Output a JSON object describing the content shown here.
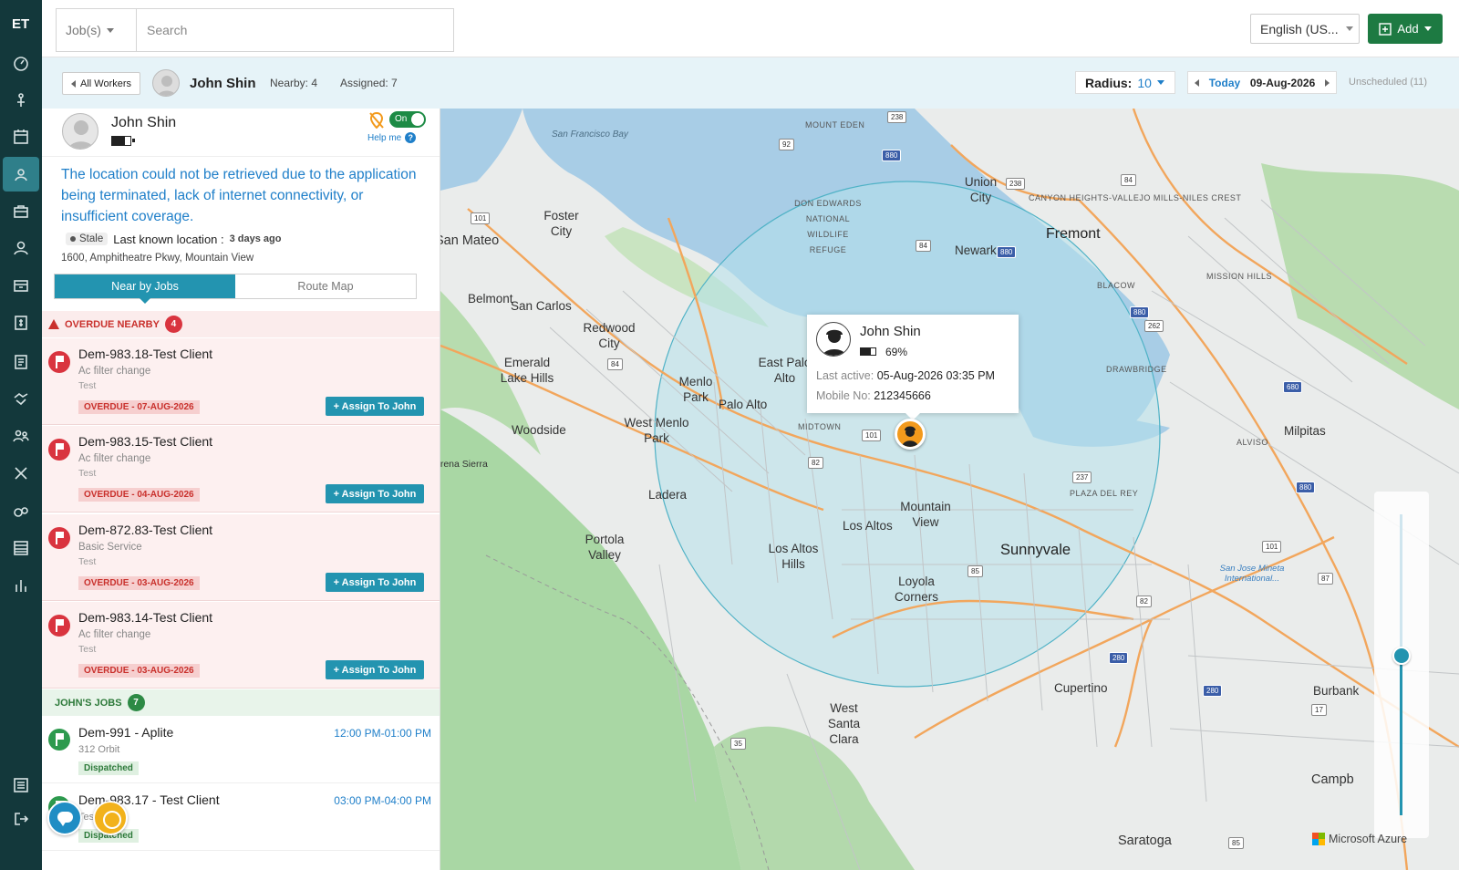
{
  "app": {
    "logo": "ET"
  },
  "rail": {
    "items": [
      "dashboard-icon",
      "route-icon",
      "calendar-icon",
      "location-user-icon",
      "briefcase-icon",
      "user-icon",
      "inventory-icon",
      "invoice-icon",
      "document-icon",
      "handshake-icon",
      "team-icon",
      "tools-icon",
      "rating-icon",
      "report-icon",
      "analytics-icon",
      "settings-icon",
      "logout-icon"
    ],
    "active_index": 3
  },
  "topbar": {
    "job_select": "Job(s)",
    "search_placeholder": "Search",
    "language": "English (US...",
    "add_label": "Add"
  },
  "subbar": {
    "all_workers": "All Workers",
    "worker_name": "John Shin",
    "nearby": "Nearby: 4",
    "assigned": "Assigned: 7",
    "radius_label": "Radius:",
    "radius_value": "10",
    "today": "Today",
    "date": "09-Aug-2026",
    "unscheduled": "Unscheduled (11)"
  },
  "panel": {
    "name": "John Shin",
    "toggle": "On",
    "help": "Help me",
    "message": "The location could not be retrieved due to the application being terminated, lack of internet connectivity, or insufficient coverage.",
    "stale": "Stale",
    "last_known": "Last known location :",
    "ago": "3 days ago",
    "address": "1600, Amphitheatre Pkwy, Mountain View",
    "tabs": [
      "Near by Jobs",
      "Route Map"
    ],
    "overdue_header": "OVERDUE NEARBY",
    "overdue_count": "4",
    "overdue_jobs": [
      {
        "title": "Dem-983.18-Test Client",
        "service": "Ac filter change",
        "note": "Test",
        "badge": "OVERDUE - 07-AUG-2026",
        "action": "+ Assign To John"
      },
      {
        "title": "Dem-983.15-Test Client",
        "service": "Ac filter change",
        "note": "Test",
        "badge": "OVERDUE - 04-AUG-2026",
        "action": "+ Assign To John"
      },
      {
        "title": "Dem-872.83-Test Client",
        "service": "Basic Service",
        "note": "Test",
        "badge": "OVERDUE - 03-AUG-2026",
        "action": "+ Assign To John"
      },
      {
        "title": "Dem-983.14-Test Client",
        "service": "Ac filter change",
        "note": "Test",
        "badge": "OVERDUE - 03-AUG-2026",
        "action": "+ Assign To John"
      }
    ],
    "my_jobs_header": "JOHN'S JOBS",
    "my_jobs_count": "7",
    "my_jobs": [
      {
        "title": "Dem-991 - Aplite",
        "sub": "312 Orbit",
        "time": "12:00 PM-01:00 PM",
        "status": "Dispatched"
      },
      {
        "title": "Dem-983.17 - Test Client",
        "sub": "Test",
        "time": "03:00 PM-04:00 PM",
        "status": "Dispatched"
      }
    ]
  },
  "map": {
    "popup": {
      "name": "John Shin",
      "battery": "69%",
      "last_active_label": "Last active:",
      "last_active": "05-Aug-2026 03:35 PM",
      "mobile_label": "Mobile No:",
      "mobile": "212345666"
    },
    "attribution": "Microsoft Azure",
    "labels": {
      "sf_bay": "San Francisco Bay",
      "mount_eden": "MOUNT EDEN",
      "union_city": "Union City",
      "canyon": "CANYON HEIGHTS-VALLEJO MILLS-NILES CREST",
      "don_edwards": "DON EDWARDS NATIONAL WILDLIFE REFUGE",
      "foster_city": "Foster City",
      "san_mateo": "San Mateo",
      "fremont": "Fremont",
      "newark": "Newark",
      "mission_hills": "MISSION HILLS",
      "belmont": "Belmont",
      "san_carlos": "San Carlos",
      "blacow": "BLACOW",
      "redwood_city": "Redwood City",
      "emerald_lake": "Emerald Lake Hills",
      "east_palo_alto": "East Palo Alto",
      "menlo_park": "Menlo Park",
      "palo_alto": "Palo Alto",
      "drawbridge": "DRAWBRIDGE",
      "woodside": "Woodside",
      "west_menlo": "West Menlo Park",
      "midtown": "MIDTOWN",
      "milpitas": "Milpitas",
      "alviso": "ALVISO",
      "lorena": "orena Sierra",
      "ladera": "Ladera",
      "mountain_view": "Mountain View",
      "plaza": "PLAZA DEL REY",
      "los_altos": "Los Altos",
      "portola": "Portola Valley",
      "los_altos_hills": "Los Altos Hills",
      "sunnyvale": "Sunnyvale",
      "sjc": "San Jose Mineta International...",
      "loyola": "Loyola Corners",
      "cupertino": "Cupertino",
      "burbank": "Burbank",
      "west_santa_clara": "West Santa Clara",
      "campbell": "Campb",
      "saratoga": "Saratoga"
    },
    "shields": [
      "238",
      "92",
      "880",
      "84",
      "238",
      "101",
      "84",
      "880",
      "880",
      "262",
      "84",
      "680",
      "101",
      "82",
      "237",
      "880",
      "101",
      "85",
      "87",
      "82",
      "280",
      "280",
      "17",
      "35",
      "85"
    ]
  }
}
